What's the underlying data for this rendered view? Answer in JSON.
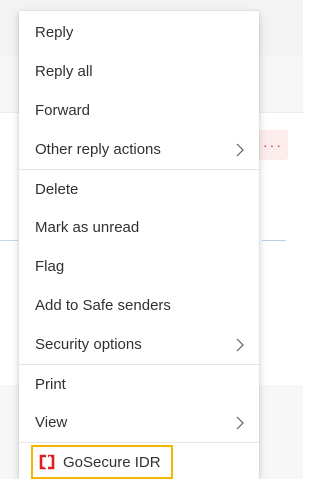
{
  "menu": {
    "items": [
      {
        "label": "Reply"
      },
      {
        "label": "Reply all"
      },
      {
        "label": "Forward"
      },
      {
        "label": "Other reply actions",
        "submenu": true
      },
      {
        "label": "Delete"
      },
      {
        "label": "Mark as unread"
      },
      {
        "label": "Flag"
      },
      {
        "label": "Add to Safe senders"
      },
      {
        "label": "Security options",
        "submenu": true
      },
      {
        "label": "Print"
      },
      {
        "label": "View",
        "submenu": true
      }
    ],
    "addin": {
      "label": "GoSecure IDR",
      "icon": "gosecure-logo-icon",
      "highlight_color": "#f2b705",
      "logo_color": "#e02020"
    }
  },
  "background": {
    "more_actions_label": "···",
    "more_actions_color": "#c4314b"
  }
}
